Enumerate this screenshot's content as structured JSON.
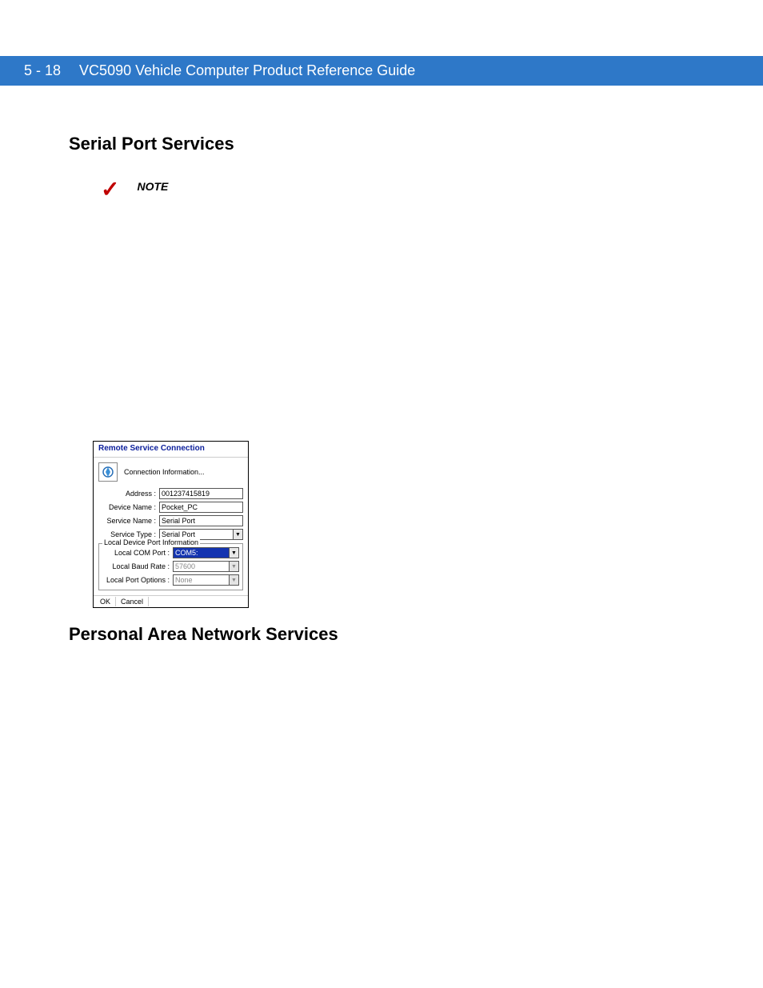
{
  "header": {
    "page_number": "5 - 18",
    "guide_title": "VC5090 Vehicle Computer Product Reference Guide"
  },
  "section1": {
    "title": "Serial Port Services",
    "note_label": "NOTE"
  },
  "dialog": {
    "title": "Remote Service Connection",
    "conn_info": "Connection Information...",
    "fields": {
      "address_label": "Address :",
      "address_value": "001237415819",
      "device_label": "Device Name :",
      "device_value": "Pocket_PC",
      "service_name_label": "Service Name :",
      "service_name_value": "Serial Port",
      "service_type_label": "Service Type :",
      "service_type_value": "Serial Port"
    },
    "group": {
      "legend": "Local Device Port Information",
      "com_label": "Local COM Port :",
      "com_value": "COM5:",
      "baud_label": "Local Baud Rate :",
      "baud_value": "57600",
      "opts_label": "Local Port Options :",
      "opts_value": "None"
    },
    "footer": {
      "ok": "OK",
      "cancel": "Cancel"
    }
  },
  "section2": {
    "title": "Personal Area Network Services"
  }
}
